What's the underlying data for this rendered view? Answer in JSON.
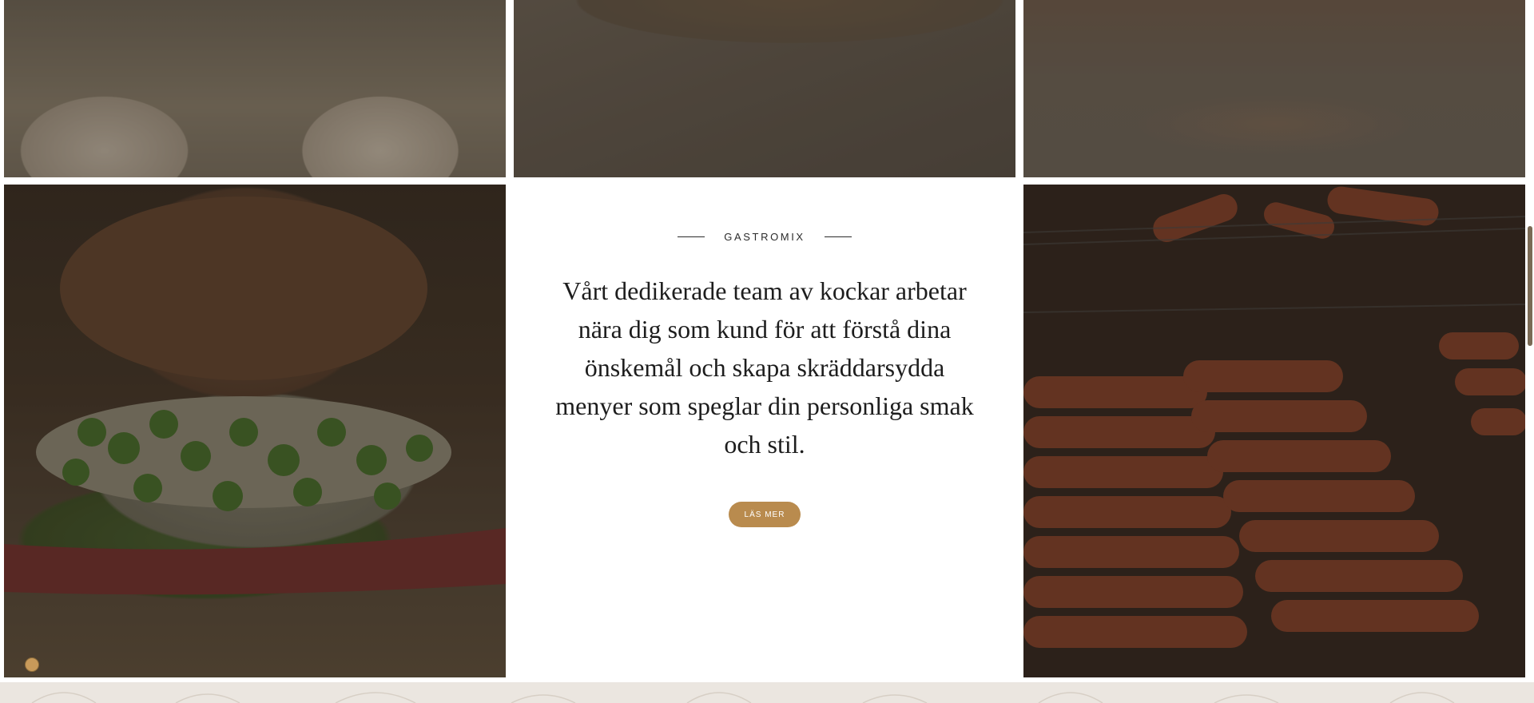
{
  "section": {
    "eyebrow": "GASTROMIX",
    "body": "Vårt dedikerade team av kockar arbetar nära dig som kund för att förstå dina önskemål och skapa skräddarsydda menyer som speglar din personliga smak och stil.",
    "button_label": "LÄS MER"
  },
  "colors": {
    "accent": "#b98b4e",
    "footer_bg": "#ebe6e0",
    "text": "#1d1d1d"
  },
  "icons": {
    "cookie": "cookie-icon"
  }
}
